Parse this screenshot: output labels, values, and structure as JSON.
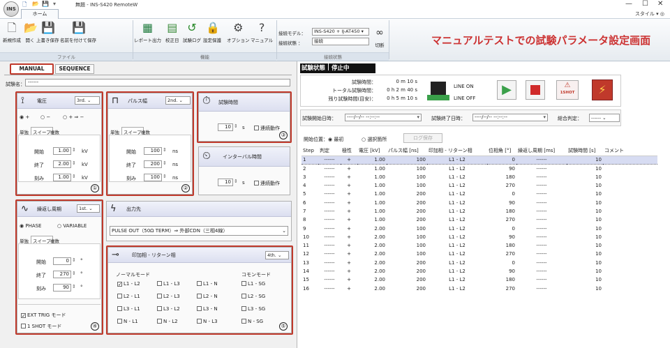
{
  "window": {
    "title": "無題 - INS-S420 RemoteW",
    "orb": "INS",
    "minimize": "—",
    "maximize": "☐",
    "close": "✕",
    "style_menu": "スタイル ▾ ◎"
  },
  "ribbon": {
    "home_tab": "ホーム",
    "file_group": "ファイル",
    "func_group": "機能",
    "conn_group": "接続状態",
    "buttons": {
      "new": "新規作成",
      "open": "開く",
      "save": "上書き保存",
      "saveas": "名前を付けて保存",
      "report": "レポート出力",
      "calib": "校正日",
      "testlog": "試験ログ",
      "protect": "設定保護",
      "option": "オプション",
      "manual": "マニュアル",
      "disconnect": "切断"
    },
    "conn_model_label": "接続モデル：",
    "conn_model_value": "INS-S420 + IJ-AT450",
    "conn_status_label": "接続状態 ：",
    "conn_status_value": "接続"
  },
  "banner": "マニュアルテストでの試験パラメータ設定画面",
  "mode_tabs": {
    "manual": "MANUAL",
    "sequence": "SEQUENCE"
  },
  "test_name": {
    "label": "試験名：",
    "value": "------"
  },
  "voltage": {
    "title": "電圧",
    "dd": "3rd.",
    "r1": "+",
    "r2": "−",
    "r3": "+ ⇒ −",
    "tabs": [
      "単独",
      "スイープ",
      "複数"
    ],
    "start_label": "開始",
    "start": "1.00",
    "end_label": "終了",
    "end": "2.00",
    "step_label": "刻み",
    "step": "1.00",
    "unit": "kV",
    "num": "①"
  },
  "pulse": {
    "title": "パルス幅",
    "dd": "2nd.",
    "tabs": [
      "単独",
      "スイープ",
      "複数"
    ],
    "start_label": "開始",
    "start": "100",
    "end_label": "終了",
    "end": "200",
    "step_label": "刻み",
    "step": "100",
    "unit": "ns",
    "num": "②"
  },
  "testtime": {
    "title": "試験時間",
    "value": "10",
    "unit": "s",
    "cont": "連続動作",
    "num": "③"
  },
  "interval": {
    "title": "インターバル時間",
    "value": "10",
    "unit": "s",
    "cont": "連続動作"
  },
  "repeat": {
    "title": "繰返し周期",
    "dd": "1st.",
    "r1": "PHASE",
    "r2": "VARIABLE",
    "tabs": [
      "単独",
      "スイープ",
      "複数"
    ],
    "start_label": "開始",
    "start": "0",
    "end_label": "終了",
    "end": "270",
    "step_label": "刻み",
    "step": "90",
    "unit": "°",
    "ext": "EXT TRIG モード",
    "oneshot": "1 SHOT モード",
    "num": "④"
  },
  "output": {
    "title": "出力先",
    "value": "PULSE OUT（50Ω TERM）⇒ 外部CDN（三相4線）"
  },
  "phase": {
    "title": "印加相 - リターン相",
    "dd": "4th.",
    "normal": "ノーマルモード",
    "common": "コモンモード",
    "normal_items": [
      "L1 - L2",
      "L1 - L3",
      "L1 - N",
      "L2 - L1",
      "L2 - L3",
      "L2 - N",
      "L3 - L1",
      "L3 - L2",
      "L3 - N",
      "N - L1",
      "N - L2",
      "N - L3"
    ],
    "common_items": [
      "L1 - SG",
      "L2 - SG",
      "L3 - SG",
      "N - SG"
    ],
    "num": "⑤"
  },
  "status": {
    "label": "試験状態",
    "value": "停止中",
    "elapsed_label": "試験時間：",
    "elapsed": "0 m 10 s",
    "total_label": "トータル試験時間：",
    "total": "0 h 2 m 40 s",
    "remain_label": "残り試験時間(目安)：",
    "remain": "0 h 5 m 10 s",
    "line_on": "LINE ON",
    "line_off": "LINE OFF",
    "oneshot": "1SHOT",
    "start_label": "試験開始日時：",
    "start_val": "----/--/-- --:--:--",
    "end_label": "試験終了日時：",
    "end_val": "----/--/-- --:--:--",
    "judge_label": "総合判定：",
    "judge_val": "------"
  },
  "startpos": {
    "label": "開始位置：",
    "r1": "最初",
    "r2": "選択箇所",
    "log": "ログ保存"
  },
  "table": {
    "headers": [
      "Step",
      "判定",
      "極性",
      "電圧 [kV]",
      "パルス幅 [ns]",
      "印加相 - リターン相",
      "位相角 [°]",
      "繰返し周期 [ms]",
      "試験時間 [s]",
      "コメント"
    ],
    "rows": [
      [
        "1",
        "------",
        "+",
        "1.00",
        "100",
        "L1 - L2",
        "0",
        "------",
        "10"
      ],
      [
        "2",
        "------",
        "+",
        "1.00",
        "100",
        "L1 - L2",
        "90",
        "------",
        "10"
      ],
      [
        "3",
        "------",
        "+",
        "1.00",
        "100",
        "L1 - L2",
        "180",
        "------",
        "10"
      ],
      [
        "4",
        "------",
        "+",
        "1.00",
        "100",
        "L1 - L2",
        "270",
        "------",
        "10"
      ],
      [
        "5",
        "------",
        "+",
        "1.00",
        "200",
        "L1 - L2",
        "0",
        "------",
        "10"
      ],
      [
        "6",
        "------",
        "+",
        "1.00",
        "200",
        "L1 - L2",
        "90",
        "------",
        "10"
      ],
      [
        "7",
        "------",
        "+",
        "1.00",
        "200",
        "L1 - L2",
        "180",
        "------",
        "10"
      ],
      [
        "8",
        "------",
        "+",
        "1.00",
        "200",
        "L1 - L2",
        "270",
        "------",
        "10"
      ],
      [
        "9",
        "------",
        "+",
        "2.00",
        "100",
        "L1 - L2",
        "0",
        "------",
        "10"
      ],
      [
        "10",
        "------",
        "+",
        "2.00",
        "100",
        "L1 - L2",
        "90",
        "------",
        "10"
      ],
      [
        "11",
        "------",
        "+",
        "2.00",
        "100",
        "L1 - L2",
        "180",
        "------",
        "10"
      ],
      [
        "12",
        "------",
        "+",
        "2.00",
        "100",
        "L1 - L2",
        "270",
        "------",
        "10"
      ],
      [
        "13",
        "------",
        "+",
        "2.00",
        "200",
        "L1 - L2",
        "0",
        "------",
        "10"
      ],
      [
        "14",
        "------",
        "+",
        "2.00",
        "200",
        "L1 - L2",
        "90",
        "------",
        "10"
      ],
      [
        "15",
        "------",
        "+",
        "2.00",
        "200",
        "L1 - L2",
        "180",
        "------",
        "10"
      ],
      [
        "16",
        "------",
        "+",
        "2.00",
        "200",
        "L1 - L2",
        "270",
        "------",
        "10"
      ]
    ]
  },
  "colors": {
    "accent": "#c0392b",
    "play": "#3aa04a",
    "stop": "#d02a2a",
    "banner": "#cc3333"
  }
}
